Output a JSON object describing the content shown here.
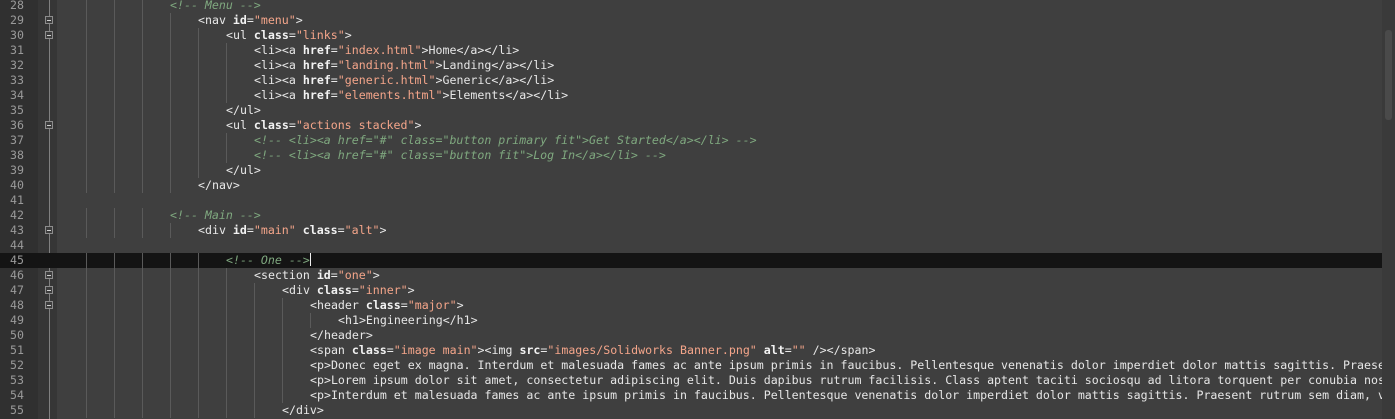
{
  "editor": {
    "first_line": 28,
    "current_line": 45,
    "lines": [
      {
        "n": "28",
        "fold": false,
        "indent": 4,
        "tokens": [
          [
            "cm",
            "<!-- Menu -->"
          ]
        ]
      },
      {
        "n": "29",
        "fold": true,
        "indent": 5,
        "tokens": [
          [
            "tg",
            "<nav "
          ],
          [
            "at",
            "id"
          ],
          [
            "tg",
            "="
          ],
          [
            "st",
            "\"menu\""
          ],
          [
            "tg",
            ">"
          ]
        ]
      },
      {
        "n": "30",
        "fold": true,
        "indent": 6,
        "tokens": [
          [
            "tg",
            "<ul "
          ],
          [
            "at",
            "class"
          ],
          [
            "tg",
            "="
          ],
          [
            "st",
            "\"links\""
          ],
          [
            "tg",
            ">"
          ]
        ]
      },
      {
        "n": "31",
        "fold": false,
        "indent": 7,
        "tokens": [
          [
            "tg",
            "<li><a "
          ],
          [
            "at",
            "href"
          ],
          [
            "tg",
            "="
          ],
          [
            "st",
            "\"index.html\""
          ],
          [
            "tg",
            ">"
          ],
          [
            "tx",
            "Home"
          ],
          [
            "tg",
            "</a></li>"
          ]
        ]
      },
      {
        "n": "32",
        "fold": false,
        "indent": 7,
        "tokens": [
          [
            "tg",
            "<li><a "
          ],
          [
            "at",
            "href"
          ],
          [
            "tg",
            "="
          ],
          [
            "st",
            "\"landing.html\""
          ],
          [
            "tg",
            ">"
          ],
          [
            "tx",
            "Landing"
          ],
          [
            "tg",
            "</a></li>"
          ]
        ]
      },
      {
        "n": "33",
        "fold": false,
        "indent": 7,
        "tokens": [
          [
            "tg",
            "<li><a "
          ],
          [
            "at",
            "href"
          ],
          [
            "tg",
            "="
          ],
          [
            "st",
            "\"generic.html\""
          ],
          [
            "tg",
            ">"
          ],
          [
            "tx",
            "Generic"
          ],
          [
            "tg",
            "</a></li>"
          ]
        ]
      },
      {
        "n": "34",
        "fold": false,
        "indent": 7,
        "tokens": [
          [
            "tg",
            "<li><a "
          ],
          [
            "at",
            "href"
          ],
          [
            "tg",
            "="
          ],
          [
            "st",
            "\"elements.html\""
          ],
          [
            "tg",
            ">"
          ],
          [
            "tx",
            "Elements"
          ],
          [
            "tg",
            "</a></li>"
          ]
        ]
      },
      {
        "n": "35",
        "fold": false,
        "indent": 6,
        "tokens": [
          [
            "tg",
            "</ul>"
          ]
        ]
      },
      {
        "n": "36",
        "fold": true,
        "indent": 6,
        "tokens": [
          [
            "tg",
            "<ul "
          ],
          [
            "at",
            "class"
          ],
          [
            "tg",
            "="
          ],
          [
            "st",
            "\"actions stacked\""
          ],
          [
            "tg",
            ">"
          ]
        ]
      },
      {
        "n": "37",
        "fold": false,
        "indent": 7,
        "tokens": [
          [
            "cm",
            "<!-- <li><a href=\"#\" class=\"button primary fit\">Get Started</a></li> -->"
          ]
        ]
      },
      {
        "n": "38",
        "fold": false,
        "indent": 7,
        "tokens": [
          [
            "cm",
            "<!-- <li><a href=\"#\" class=\"button fit\">Log In</a></li> -->"
          ]
        ]
      },
      {
        "n": "39",
        "fold": false,
        "indent": 6,
        "tokens": [
          [
            "tg",
            "</ul>"
          ]
        ]
      },
      {
        "n": "40",
        "fold": false,
        "indent": 5,
        "tokens": [
          [
            "tg",
            "</nav>"
          ]
        ]
      },
      {
        "n": "41",
        "fold": false,
        "indent": 0,
        "tokens": []
      },
      {
        "n": "42",
        "fold": false,
        "indent": 4,
        "tokens": [
          [
            "cm",
            "<!-- Main -->"
          ]
        ]
      },
      {
        "n": "43",
        "fold": true,
        "indent": 5,
        "tokens": [
          [
            "tg",
            "<div "
          ],
          [
            "at",
            "id"
          ],
          [
            "tg",
            "="
          ],
          [
            "st",
            "\"main\""
          ],
          [
            "tg",
            " "
          ],
          [
            "at",
            "class"
          ],
          [
            "tg",
            "="
          ],
          [
            "st",
            "\"alt\""
          ],
          [
            "tg",
            ">"
          ]
        ]
      },
      {
        "n": "44",
        "fold": false,
        "indent": 0,
        "tokens": []
      },
      {
        "n": "45",
        "fold": false,
        "indent": 6,
        "tokens": [
          [
            "cm",
            "<!-- One -->"
          ]
        ],
        "caret": true
      },
      {
        "n": "46",
        "fold": true,
        "indent": 7,
        "tokens": [
          [
            "tg",
            "<section "
          ],
          [
            "at",
            "id"
          ],
          [
            "tg",
            "="
          ],
          [
            "st",
            "\"one\""
          ],
          [
            "tg",
            ">"
          ]
        ]
      },
      {
        "n": "47",
        "fold": true,
        "indent": 8,
        "tokens": [
          [
            "tg",
            "<div "
          ],
          [
            "at",
            "class"
          ],
          [
            "tg",
            "="
          ],
          [
            "st",
            "\"inner\""
          ],
          [
            "tg",
            ">"
          ]
        ]
      },
      {
        "n": "48",
        "fold": true,
        "indent": 9,
        "tokens": [
          [
            "tg",
            "<header "
          ],
          [
            "at",
            "class"
          ],
          [
            "tg",
            "="
          ],
          [
            "st",
            "\"major\""
          ],
          [
            "tg",
            ">"
          ]
        ]
      },
      {
        "n": "49",
        "fold": false,
        "indent": 10,
        "tokens": [
          [
            "tg",
            "<h1>"
          ],
          [
            "tx",
            "Engineering"
          ],
          [
            "tg",
            "</h1>"
          ]
        ]
      },
      {
        "n": "50",
        "fold": false,
        "indent": 9,
        "tokens": [
          [
            "tg",
            "</header>"
          ]
        ]
      },
      {
        "n": "51",
        "fold": false,
        "indent": 9,
        "tokens": [
          [
            "tg",
            "<span "
          ],
          [
            "at",
            "class"
          ],
          [
            "tg",
            "="
          ],
          [
            "st",
            "\"image main\""
          ],
          [
            "tg",
            "><img "
          ],
          [
            "at",
            "src"
          ],
          [
            "tg",
            "="
          ],
          [
            "st",
            "\"images/Solidworks Banner.png\""
          ],
          [
            "tg",
            " "
          ],
          [
            "at",
            "alt"
          ],
          [
            "tg",
            "="
          ],
          [
            "st",
            "\"\""
          ],
          [
            "tg",
            " /></span>"
          ]
        ]
      },
      {
        "n": "52",
        "fold": false,
        "indent": 9,
        "tokens": [
          [
            "tg",
            "<p>"
          ],
          [
            "tx",
            "Donec eget ex magna. Interdum et malesuada fames ac ante ipsum primis in faucibus. Pellentesque venenatis dolor imperdiet dolor mattis sagittis. Praesen"
          ]
        ]
      },
      {
        "n": "53",
        "fold": false,
        "indent": 9,
        "tokens": [
          [
            "tg",
            "<p>"
          ],
          [
            "tx",
            "Lorem ipsum dolor sit amet, consectetur adipiscing elit. Duis dapibus rutrum facilisis. Class aptent taciti sociosqu ad litora torquent per conubia nost"
          ]
        ]
      },
      {
        "n": "54",
        "fold": false,
        "indent": 9,
        "tokens": [
          [
            "tg",
            "<p>"
          ],
          [
            "tx",
            "Interdum et malesuada fames ac ante ipsum primis in faucibus. Pellentesque venenatis dolor imperdiet dolor mattis sagittis. Praesent rutrum sem diam, vi"
          ]
        ]
      },
      {
        "n": "55",
        "fold": false,
        "indent": 8,
        "tokens": [
          [
            "tg",
            "</div>"
          ]
        ]
      }
    ]
  },
  "colors": {
    "background": "#3f3f3f",
    "gutter": "#303030",
    "current_line": "#141414",
    "comment": "#7fa87f",
    "string": "#f4a58a"
  }
}
